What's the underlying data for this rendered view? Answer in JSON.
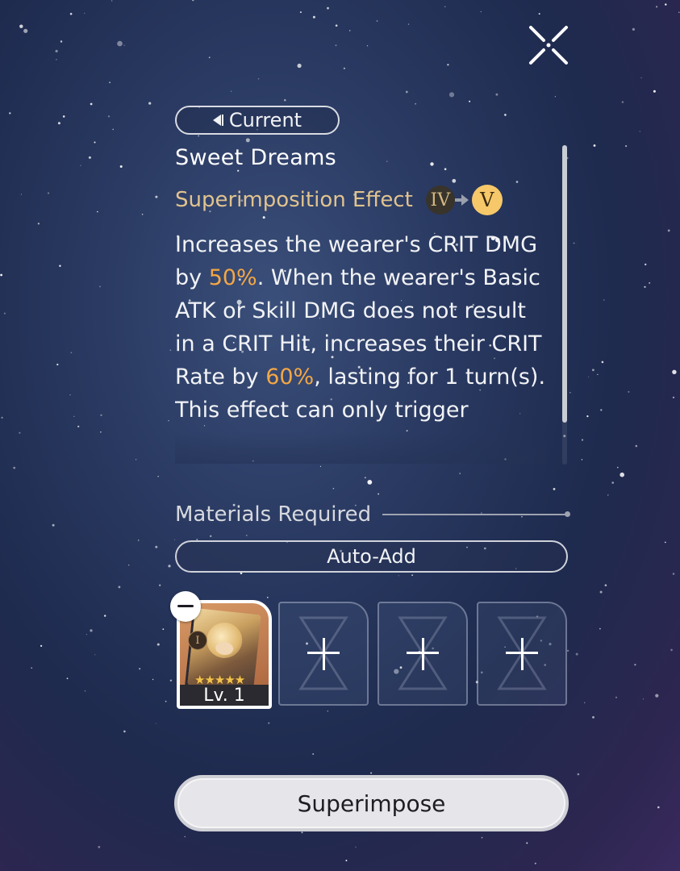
{
  "current_button": {
    "label": "Current"
  },
  "light_cone": {
    "name": "Sweet Dreams"
  },
  "superimposition": {
    "label": "Superimposition Effect",
    "current_rank": "IV",
    "next_rank": "V"
  },
  "description": {
    "part1": "Increases the wearer's CRIT DMG by ",
    "value1": "50%",
    "part2": ". When the wearer's Basic ATK or Skill DMG does not result in a CRIT Hit, increases their CRIT Rate by ",
    "value2": "60%",
    "part3": ", lasting for 1 turn(s). This effect can only trigger"
  },
  "materials": {
    "label": "Materials Required",
    "auto_add_label": "Auto-Add",
    "slots": [
      {
        "filled": true,
        "level": "Lv. 1",
        "rank": "I",
        "stars": "★★★★★"
      },
      {
        "filled": false
      },
      {
        "filled": false
      },
      {
        "filled": false
      }
    ]
  },
  "action": {
    "label": "Superimpose"
  },
  "colors": {
    "accent_gold": "#e1c38e",
    "highlight_orange": "#f4a744",
    "next_rank_gold": "#f6c869"
  }
}
